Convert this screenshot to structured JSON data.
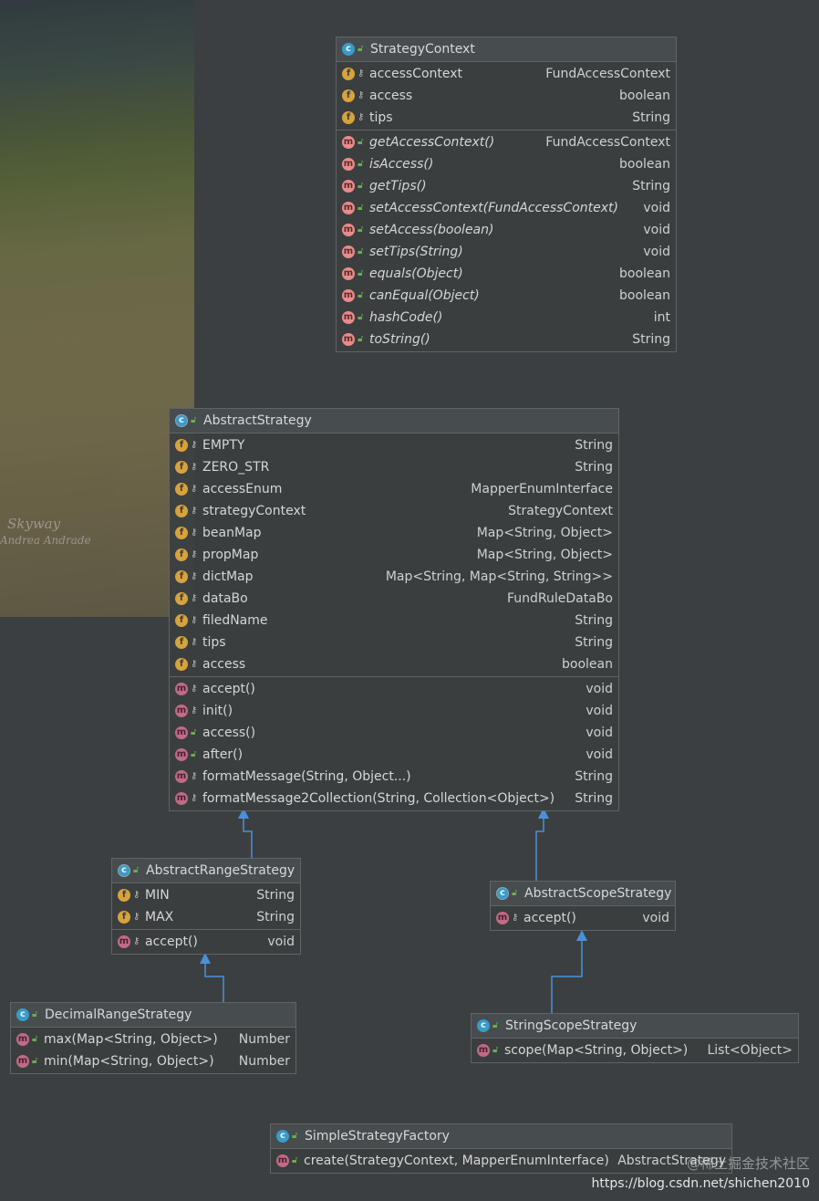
{
  "background": {
    "signature_line1": "Skyway",
    "signature_line2": "Andrea Andrade"
  },
  "classes": {
    "strategy_context": {
      "name": "StrategyContext",
      "fields": [
        {
          "name": "accessContext",
          "type": "FundAccessContext"
        },
        {
          "name": "access",
          "type": "boolean"
        },
        {
          "name": "tips",
          "type": "String"
        }
      ],
      "methods": [
        {
          "name": "getAccessContext()",
          "type": "FundAccessContext"
        },
        {
          "name": "isAccess()",
          "type": "boolean"
        },
        {
          "name": "getTips()",
          "type": "String"
        },
        {
          "name": "setAccessContext(FundAccessContext)",
          "type": "void"
        },
        {
          "name": "setAccess(boolean)",
          "type": "void"
        },
        {
          "name": "setTips(String)",
          "type": "void"
        },
        {
          "name": "equals(Object)",
          "type": "boolean"
        },
        {
          "name": "canEqual(Object)",
          "type": "boolean"
        },
        {
          "name": "hashCode()",
          "type": "int"
        },
        {
          "name": "toString()",
          "type": "String"
        }
      ]
    },
    "abstract_strategy": {
      "name": "AbstractStrategy",
      "fields": [
        {
          "name": "EMPTY",
          "type": "String"
        },
        {
          "name": "ZERO_STR",
          "type": "String"
        },
        {
          "name": "accessEnum",
          "type": "MapperEnumInterface"
        },
        {
          "name": "strategyContext",
          "type": "StrategyContext"
        },
        {
          "name": "beanMap",
          "type": "Map<String, Object>"
        },
        {
          "name": "propMap",
          "type": "Map<String, Object>"
        },
        {
          "name": "dictMap",
          "type": "Map<String, Map<String, String>>"
        },
        {
          "name": "dataBo",
          "type": "FundRuleDataBo"
        },
        {
          "name": "filedName",
          "type": "String"
        },
        {
          "name": "tips",
          "type": "String"
        },
        {
          "name": "access",
          "type": "boolean"
        }
      ],
      "methods": [
        {
          "name": "accept()",
          "type": "void"
        },
        {
          "name": "init()",
          "type": "void"
        },
        {
          "name": "access()",
          "type": "void"
        },
        {
          "name": "after()",
          "type": "void"
        },
        {
          "name": "formatMessage(String, Object...)",
          "type": "String"
        },
        {
          "name": "formatMessage2Collection(String, Collection<Object>)",
          "type": "String"
        }
      ]
    },
    "abstract_range_strategy": {
      "name": "AbstractRangeStrategy",
      "fields": [
        {
          "name": "MIN",
          "type": "String"
        },
        {
          "name": "MAX",
          "type": "String"
        }
      ],
      "methods": [
        {
          "name": "accept()",
          "type": "void"
        }
      ]
    },
    "abstract_scope_strategy": {
      "name": "AbstractScopeStrategy",
      "methods": [
        {
          "name": "accept()",
          "type": "void"
        }
      ]
    },
    "decimal_range_strategy": {
      "name": "DecimalRangeStrategy",
      "methods": [
        {
          "name": "max(Map<String, Object>)",
          "type": "Number"
        },
        {
          "name": "min(Map<String, Object>)",
          "type": "Number"
        }
      ]
    },
    "string_scope_strategy": {
      "name": "StringScopeStrategy",
      "methods": [
        {
          "name": "scope(Map<String, Object>)",
          "type": "List<Object>"
        }
      ]
    },
    "simple_strategy_factory": {
      "name": "SimpleStrategyFactory",
      "methods": [
        {
          "name": "create(StrategyContext, MapperEnumInterface)",
          "type": "AbstractStrategy"
        }
      ]
    }
  },
  "watermark": {
    "line1": "@稀土掘金技术社区",
    "line2": "https://blog.csdn.net/shichen2010"
  },
  "colors": {
    "background": "#3c3f41",
    "class_icon": "#3a9ac9",
    "field_icon": "#d8a23c",
    "method_icon": "#e88b8b",
    "arrow": "#4a90d9"
  }
}
